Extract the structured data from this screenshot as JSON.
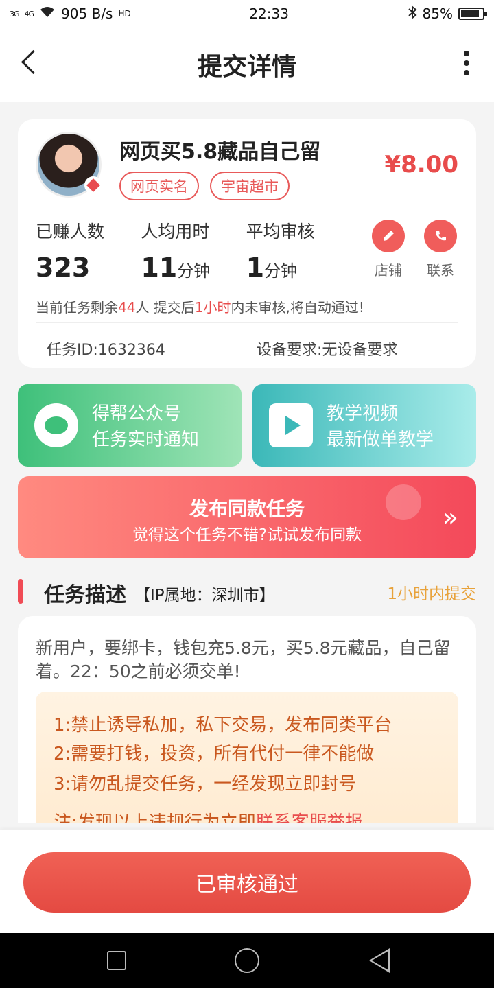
{
  "status_bar": {
    "network_left": "3G",
    "network_right": "4G",
    "speed": "905 B/s",
    "hd": "HD",
    "time": "22:33",
    "battery": "85%",
    "battery_level": 0.85
  },
  "header": {
    "title": "提交详情"
  },
  "task": {
    "title": "网页买5.8藏品自己留",
    "tags": [
      "网页实名",
      "宇宙超市"
    ],
    "price": "¥8.00",
    "stats": [
      {
        "label": "已赚人数",
        "value": "323",
        "unit": ""
      },
      {
        "label": "人均用时",
        "value": "11",
        "unit": "分钟"
      },
      {
        "label": "平均审核",
        "value": "1",
        "unit": "分钟"
      }
    ],
    "actions": [
      {
        "label": "店铺",
        "icon": "pencil-icon"
      },
      {
        "label": "联系",
        "icon": "phone-icon"
      }
    ],
    "notice": {
      "p1": "当前任务剩余",
      "remaining": "44",
      "p2": "人  提交后",
      "deadline": "1小时",
      "p3": "内未审核,将自动通过!"
    },
    "task_id": "任务ID:1632364",
    "device": "设备要求:无设备要求"
  },
  "banners": {
    "wechat": {
      "line1": "得帮公众号",
      "line2": "任务实时通知"
    },
    "video": {
      "line1": "教学视频",
      "line2": "最新做单教学"
    }
  },
  "publish": {
    "title": "发布同款任务",
    "subtitle": "觉得这个任务不错?试试发布同款",
    "chevron": "»"
  },
  "description": {
    "section_title": "任务描述",
    "ip": "【IP属地：深圳市】",
    "time_limit": "1小时内提交",
    "text": "新用户，要绑卡，钱包充5.8元，买5.8元藏品，自己留着。22：50之前必须交单!",
    "rules": [
      "1:禁止诱导私加，私下交易，发布同类平台",
      "2:需要打钱，投资，所有代付一律不能做",
      "3:请勿乱提交任务，一经发现立即封号"
    ],
    "rule_note_a": "注:发现以上违规行为立即",
    "rule_note_b": "联系客服举报"
  },
  "bottom": {
    "button": "已审核通过"
  },
  "colors": {
    "accent": "#e84c4c",
    "orange": "#e8a23a",
    "green": "#3ec07a",
    "teal": "#3bb8b8"
  }
}
